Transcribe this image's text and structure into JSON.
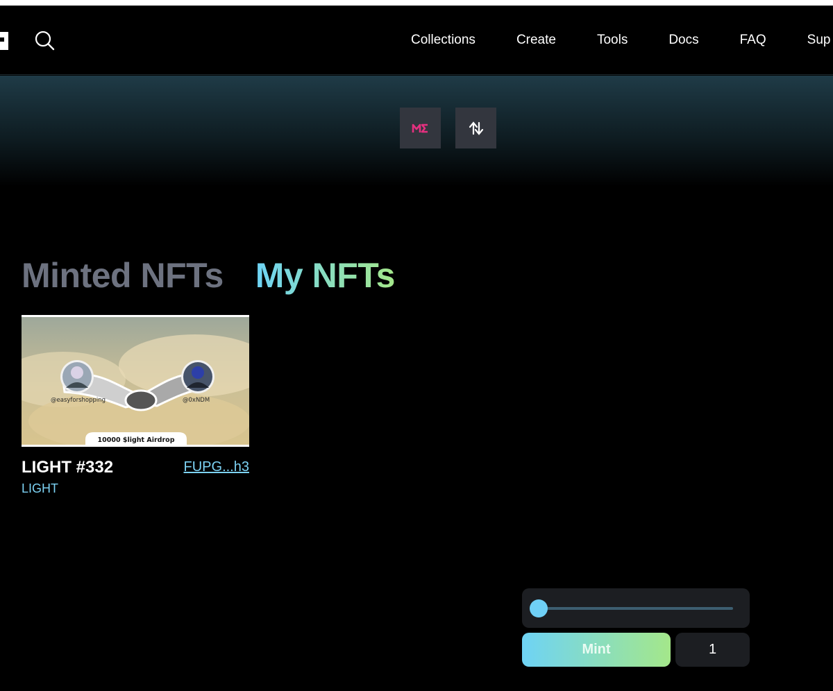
{
  "header": {
    "nav": [
      {
        "label": "Collections"
      },
      {
        "label": "Create"
      },
      {
        "label": "Tools"
      },
      {
        "label": "Docs"
      },
      {
        "label": "FAQ"
      },
      {
        "label": "Sup"
      }
    ],
    "icons": {
      "search": "search-icon",
      "logo": "logo-icon"
    }
  },
  "banner": {
    "buttons": [
      {
        "icon": "magic-eden-icon",
        "label": "ME"
      },
      {
        "icon": "swap-arrows-icon"
      }
    ],
    "accent": "#e4307f"
  },
  "tabs": {
    "minted": "Minted NFTs",
    "mine": "My NFTs",
    "active": "mine"
  },
  "nft": {
    "name": "LIGHT #332",
    "address": "FUPG...h3",
    "collection": "LIGHT",
    "image": {
      "left_handle": "@easyforshopping",
      "right_handle": "@0xNDM",
      "caption": "10000 $light Airdrop"
    }
  },
  "mint": {
    "button_label": "Mint",
    "quantity": "1",
    "slider_value": 0.0
  },
  "colors": {
    "accent_gradient_start": "#6ed3f5",
    "accent_gradient_end": "#a4e78a",
    "link": "#7dd3f5",
    "inactive_tab": "#6d7280"
  }
}
